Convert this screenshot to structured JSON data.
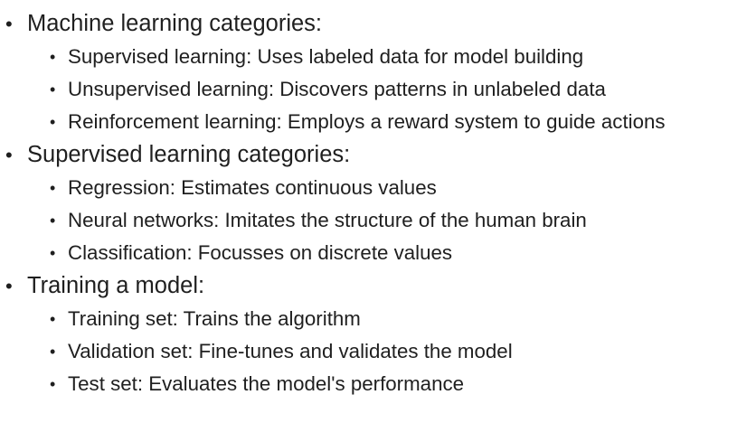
{
  "sections": [
    {
      "title": "Machine learning categories:",
      "items": [
        "Supervised learning: Uses labeled data for model building",
        "Unsupervised learning: Discovers patterns in unlabeled data",
        "Reinforcement learning: Employs a reward system to guide actions"
      ]
    },
    {
      "title": "Supervised learning categories:",
      "items": [
        "Regression: Estimates continuous values",
        "Neural networks: Imitates the structure of the human brain",
        "Classification: Focusses on discrete values"
      ]
    },
    {
      "title": "Training a model:",
      "items": [
        "Training set: Trains the algorithm",
        "Validation set: Fine-tunes and validates the model",
        "Test set: Evaluates the model's performance"
      ]
    }
  ]
}
